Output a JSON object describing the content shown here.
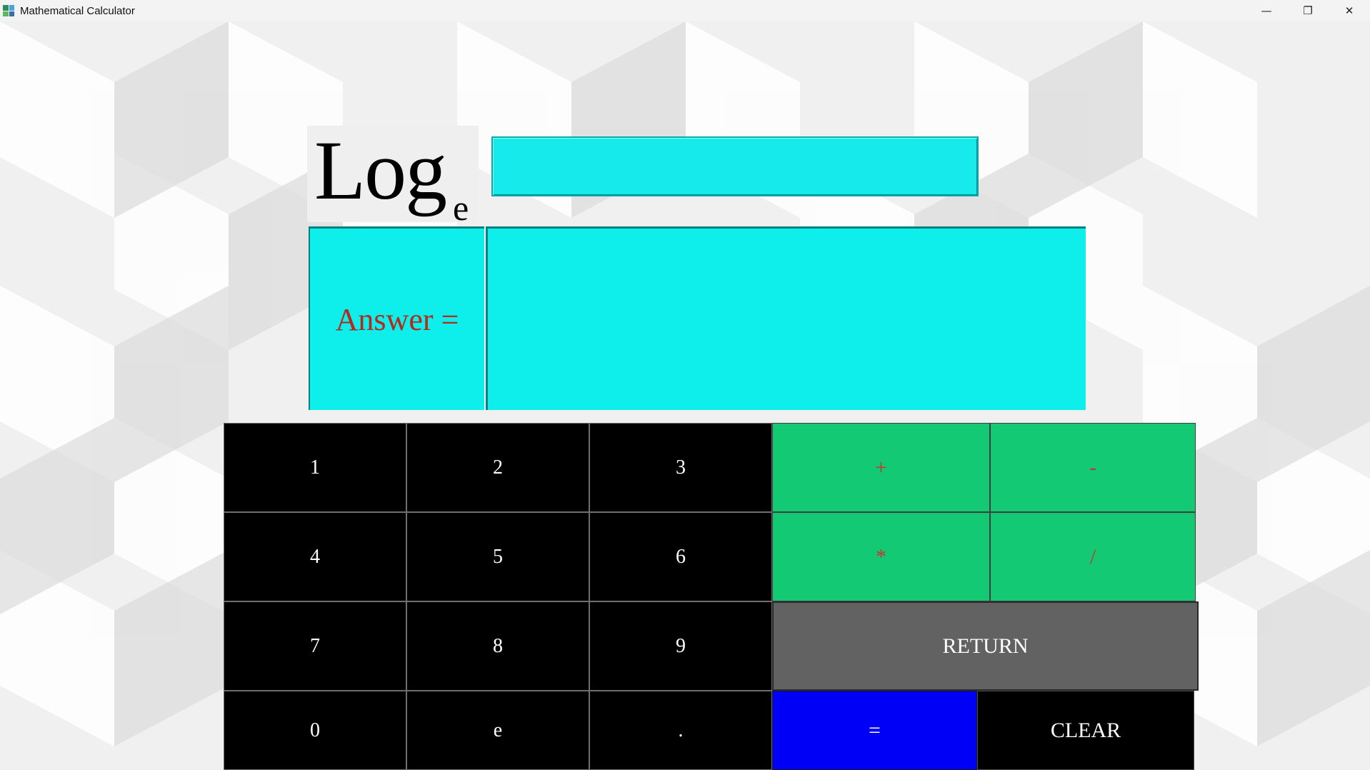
{
  "window": {
    "title": "Mathematical Calculator",
    "icon": "calculator-app-icon",
    "controls": {
      "minimize": "—",
      "restore": "❐",
      "close": "✕"
    }
  },
  "function": {
    "label_main": "Log",
    "label_subscript": "e",
    "input_value": ""
  },
  "answer": {
    "label": "Answer =",
    "value": ""
  },
  "keypad": {
    "digits": {
      "k1": "1",
      "k2": "2",
      "k3": "3",
      "k4": "4",
      "k5": "5",
      "k6": "6",
      "k7": "7",
      "k8": "8",
      "k9": "9",
      "k0": "0",
      "ke": "e",
      "kdot": "."
    },
    "operators": {
      "plus": "+",
      "minus": "-",
      "multiply": "*",
      "divide": "/"
    },
    "return_label": "RETURN",
    "equals_label": "=",
    "clear_label": "CLEAR"
  },
  "colors": {
    "display_cyan": "#0eeeea",
    "operator_green": "#13c974",
    "operator_text_red": "#c0392b",
    "answer_label_red": "#b42a1f",
    "return_gray": "#616261",
    "equals_blue": "#0000f7",
    "digit_black": "#000000"
  }
}
